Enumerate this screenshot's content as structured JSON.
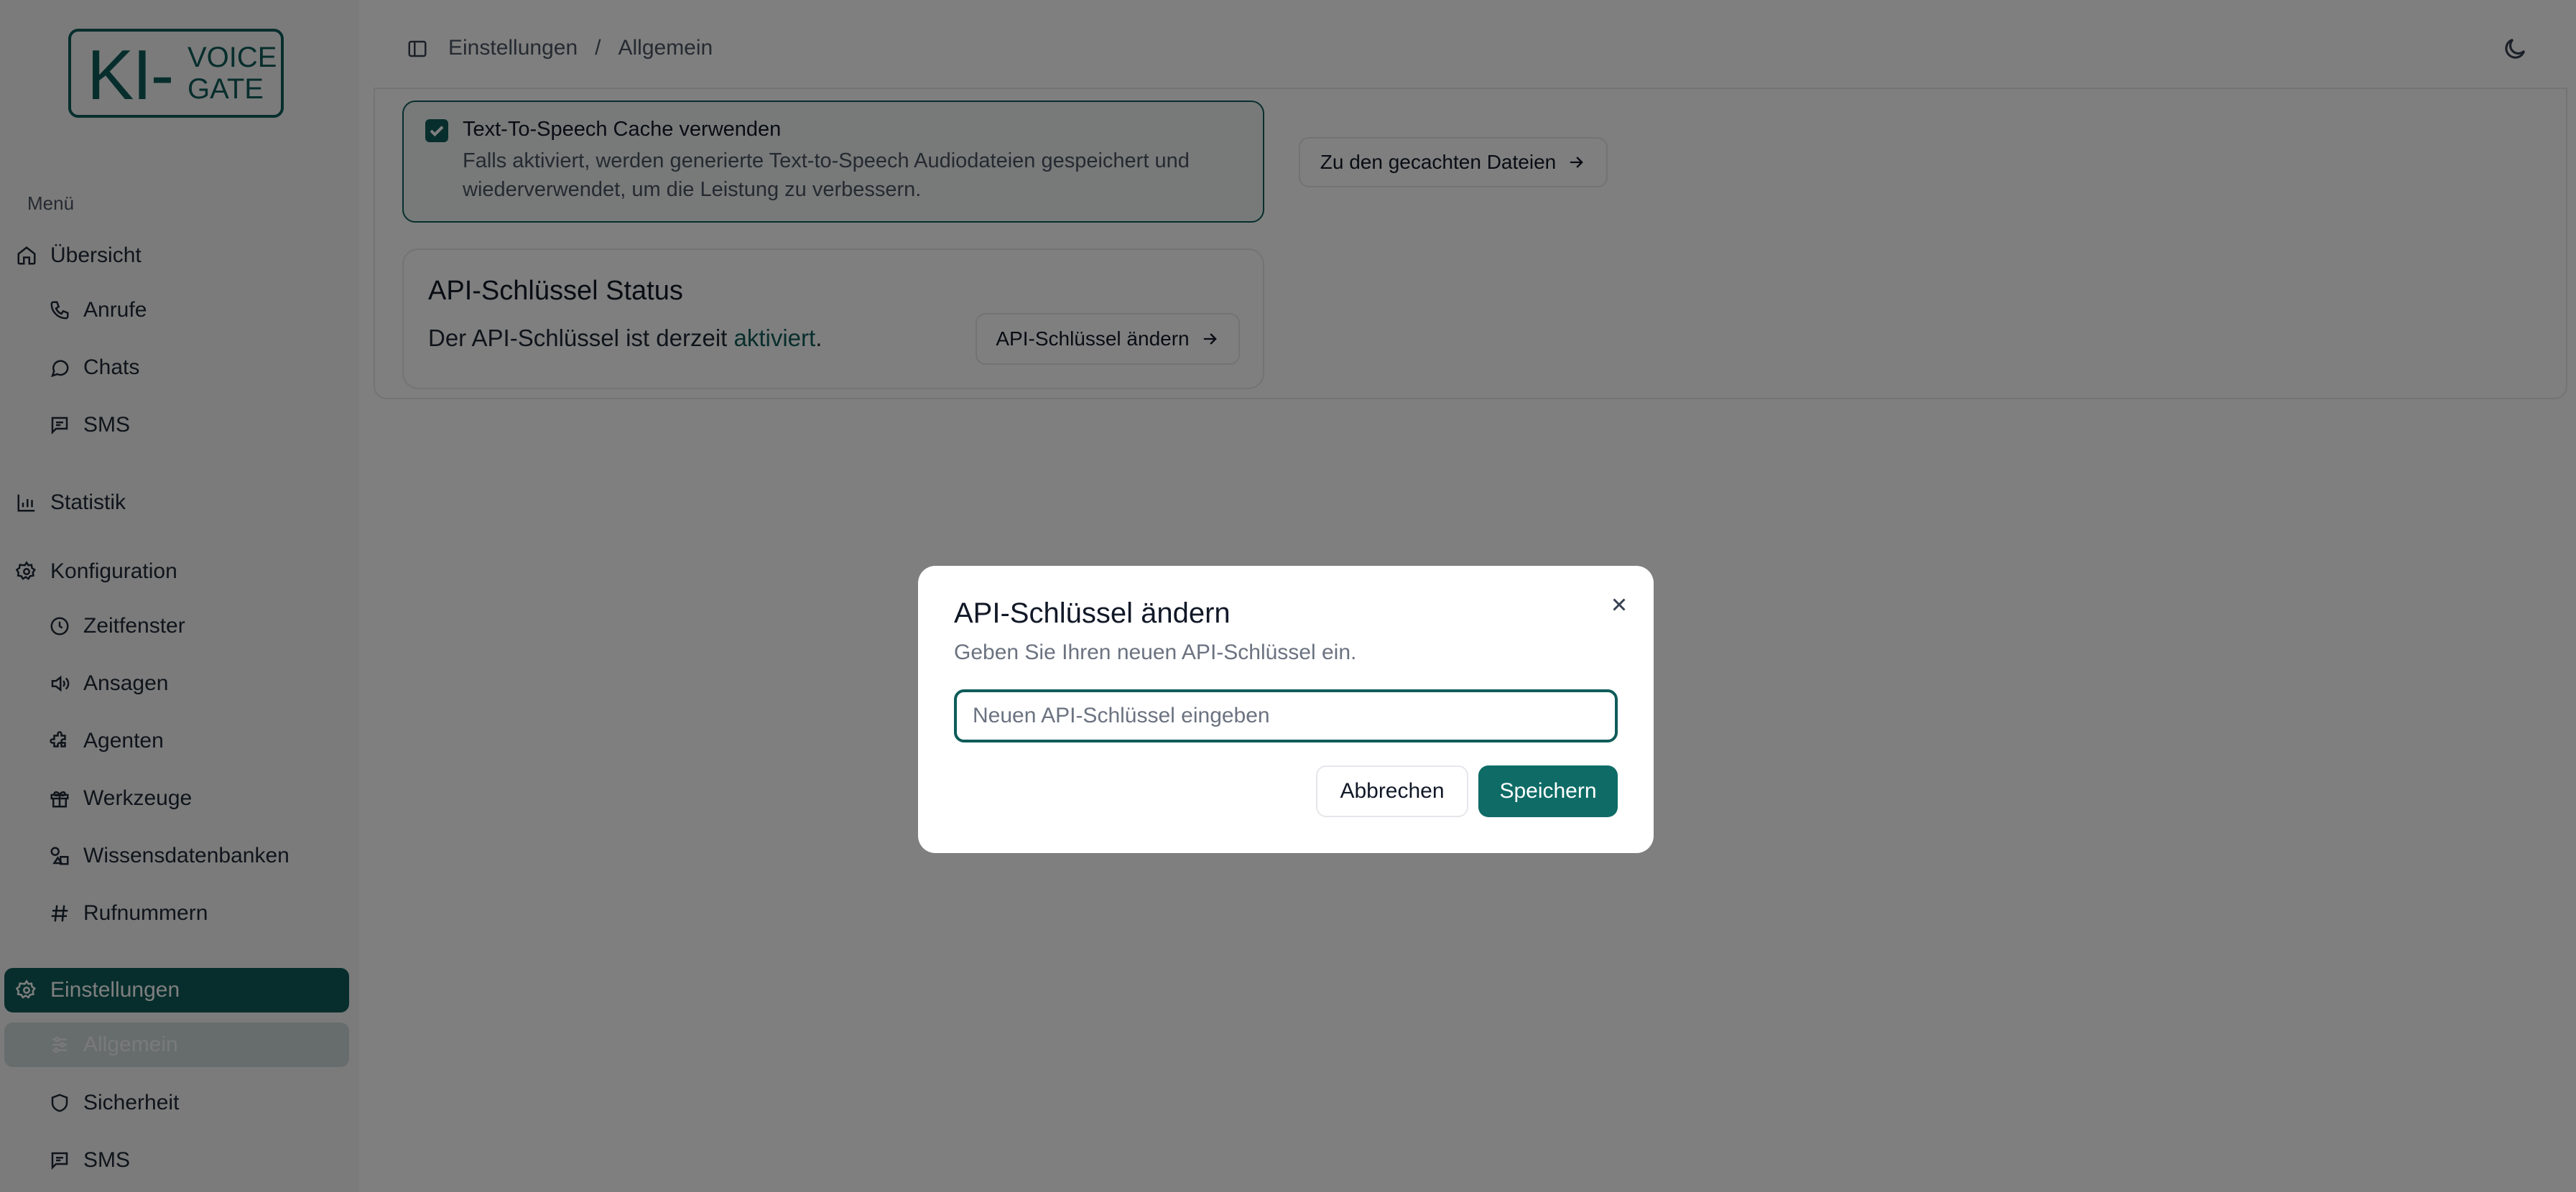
{
  "brand": {
    "logo_main": "KI-",
    "logo_top": "VOICE",
    "logo_bottom": "GATE"
  },
  "sidebar": {
    "menu_label": "Menü",
    "items": [
      {
        "label": "Übersicht",
        "icon": "home-icon"
      },
      {
        "label": "Anrufe",
        "icon": "phone-icon"
      },
      {
        "label": "Chats",
        "icon": "chat-bubble-icon"
      },
      {
        "label": "SMS",
        "icon": "message-square-icon"
      },
      {
        "label": "Statistik",
        "icon": "bar-chart-icon"
      },
      {
        "label": "Konfiguration",
        "icon": "gear-icon"
      },
      {
        "label": "Zeitfenster",
        "icon": "clock-icon"
      },
      {
        "label": "Ansagen",
        "icon": "speaker-icon"
      },
      {
        "label": "Agenten",
        "icon": "puzzle-icon"
      },
      {
        "label": "Werkzeuge",
        "icon": "gift-box-icon"
      },
      {
        "label": "Wissensdatenbanken",
        "icon": "shapes-icon"
      },
      {
        "label": "Rufnummern",
        "icon": "hash-icon"
      },
      {
        "label": "Einstellungen",
        "icon": "gear-icon"
      },
      {
        "label": "Allgemein",
        "icon": "sliders-icon"
      },
      {
        "label": "Sicherheit",
        "icon": "shield-icon"
      },
      {
        "label": "SMS",
        "icon": "message-square-icon"
      }
    ]
  },
  "header": {
    "breadcrumb": [
      "Einstellungen",
      "/",
      "Allgemein"
    ]
  },
  "tts_card": {
    "checkbox_label": "Text-To-Speech Cache verwenden",
    "description_line1": "Falls aktiviert, werden generierte Text-to-Speech Audiodateien gespeichert und",
    "description_line2": "wiederverwendet, um die Leistung zu verbessern.",
    "checked": true,
    "cached_files_button": "Zu den gecachten Dateien"
  },
  "api_card": {
    "title": "API-Schlüssel Status",
    "status_prefix": "Der API-Schlüssel ist derzeit ",
    "status_value": "aktiviert",
    "status_suffix": ".",
    "change_button": "API-Schlüssel ändern"
  },
  "modal": {
    "title": "API-Schlüssel ändern",
    "description": "Geben Sie Ihren neuen API-Schlüssel ein.",
    "input_value": "",
    "input_placeholder": "Neuen API-Schlüssel eingeben",
    "cancel_label": "Abbrechen",
    "save_label": "Speichern"
  },
  "colors": {
    "accent": "#0e5c59",
    "accent_button": "#0e6b66",
    "overlay": "rgba(0,0,0,0.5)"
  }
}
